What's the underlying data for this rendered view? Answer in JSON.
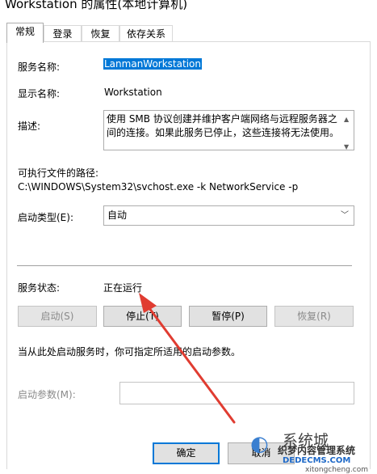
{
  "window": {
    "title": "Workstation 的属性(本地计算机)"
  },
  "tabs": [
    {
      "label": "常规"
    },
    {
      "label": "登录"
    },
    {
      "label": "恢复"
    },
    {
      "label": "依存关系"
    }
  ],
  "general": {
    "service_name_label": "服务名称:",
    "service_name_value": "LanmanWorkstation",
    "display_name_label": "显示名称:",
    "display_name_value": "Workstation",
    "description_label": "描述:",
    "description_value": "使用 SMB 协议创建并维护客户端网络与远程服务器之间的连接。如果此服务已停止，这些连接将无法使用。",
    "path_label": "可执行文件的路径:",
    "path_value": "C:\\WINDOWS\\System32\\svchost.exe -k NetworkService -p",
    "startup_type_label": "启动类型(E):",
    "startup_type_value": "自动",
    "status_label": "服务状态:",
    "status_value": "正在运行",
    "buttons": {
      "start": "启动(S)",
      "stop": "停止(T)",
      "pause": "暂停(P)",
      "resume": "恢复(R)"
    },
    "hint": "当从此处启动服务时，你可指定所适用的启动参数。",
    "start_params_label": "启动参数(M):",
    "start_params_value": ""
  },
  "footer": {
    "ok": "确定",
    "cancel": "取消"
  },
  "watermark": {
    "line1": "系统城",
    "line2": "织梦内容管理系统",
    "line3": "DEDECMS.COM",
    "line4": "xitongcheng.com"
  },
  "colors": {
    "selection": "#0078d7",
    "annotation_arrow": "#e03c31"
  }
}
